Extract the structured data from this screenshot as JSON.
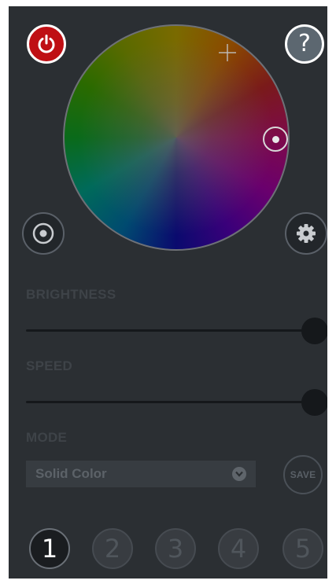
{
  "controls": {
    "help_label": "?"
  },
  "brightness": {
    "label": "BRIGHTNESS",
    "value": 1.0
  },
  "speed": {
    "label": "SPEED",
    "value": 1.0
  },
  "mode": {
    "label": "MODE",
    "selected": "Solid Color"
  },
  "save_label": "SAVE",
  "presets": [
    {
      "label": "1",
      "active": true
    },
    {
      "label": "2",
      "active": false
    },
    {
      "label": "3",
      "active": false
    },
    {
      "label": "4",
      "active": false
    },
    {
      "label": "5",
      "active": false
    }
  ],
  "colors": {
    "background": "#2b2f33",
    "power": "#bf0f14",
    "help": "#5c6770",
    "muted_text": "#3e4348"
  },
  "icons": [
    "power-icon",
    "question-mark-icon",
    "target-icon",
    "gear-icon",
    "chevron-down-icon",
    "crosshair-icon",
    "selector-ring-icon"
  ]
}
